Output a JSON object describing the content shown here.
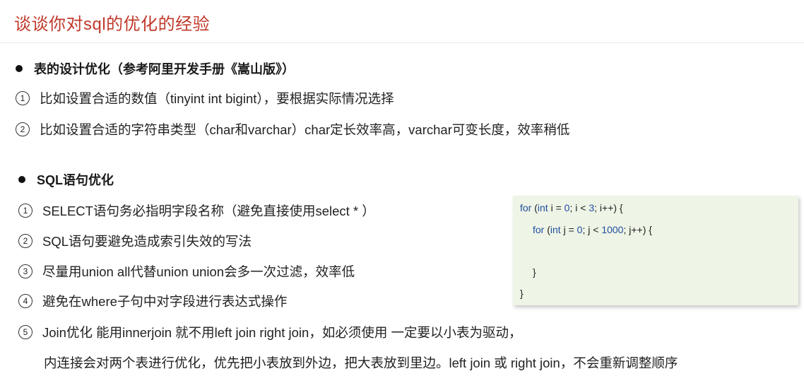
{
  "title": "谈谈你对sql的优化的经验",
  "section1": {
    "heading": "表的设计优化（参考阿里开发手册《嵩山版》）",
    "items": [
      {
        "num": "1",
        "text": "比如设置合适的数值（tinyint   int   bigint），要根据实际情况选择"
      },
      {
        "num": "2",
        "text": "比如设置合适的字符串类型（char和varchar）char定长效率高，varchar可变长度，效率稍低"
      }
    ]
  },
  "section2": {
    "heading": "SQL语句优化",
    "items": [
      {
        "num": "1",
        "text": "SELECT语句务必指明字段名称（避免直接使用select * ）"
      },
      {
        "num": "2",
        "text": "SQL语句要避免造成索引失效的写法"
      },
      {
        "num": "3",
        "text": "尽量用union all代替union   union会多一次过滤，效率低"
      },
      {
        "num": "4",
        "text": "避免在where子句中对字段进行表达式操作"
      },
      {
        "num": "5",
        "text": "Join优化 能用innerjoin 就不用left join right join，如必须使用 一定要以小表为驱动，"
      }
    ],
    "continuation": "内连接会对两个表进行优化，优先把小表放到外边，把大表放到里边。left join 或 right join，不会重新调整顺序"
  },
  "code": {
    "line1": {
      "kw": "for",
      "a": " (",
      "type": "int",
      "b": " i = ",
      "n1": "0",
      "c": "; i < ",
      "n2": "3",
      "d": "; i++) {"
    },
    "line2": {
      "kw": "for",
      "a": " (",
      "type": "int",
      "b": " j = ",
      "n1": "0",
      "c": "; j < ",
      "n2": "1000",
      "d": "; j++) {"
    },
    "line3": "}",
    "line4": "}"
  }
}
